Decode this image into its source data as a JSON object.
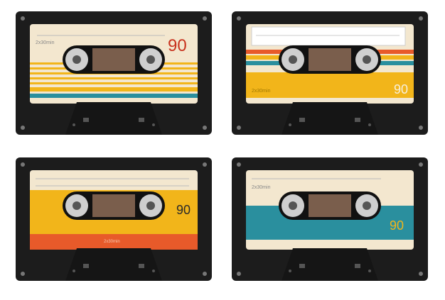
{
  "cassettes": [
    {
      "id": "cassette-1",
      "duration_label": "2x30min",
      "number": "90",
      "number_color": "#c8321e",
      "label_color": "#f3e7cf",
      "stripe_colors": [
        "#f2b51a",
        "#f2b51a",
        "#f2b51a",
        "#f2b51a",
        "#f2b51a",
        "#f2b51a",
        "#2a8f9e"
      ]
    },
    {
      "id": "cassette-2",
      "duration_label": "2x30min",
      "number": "90",
      "number_color": "#f2b51a",
      "label_color": "#f3e7cf",
      "stripe_colors": [
        "#e85a2a",
        "#f2b51a",
        "#2a8f9e",
        "#f2b51a"
      ]
    },
    {
      "id": "cassette-3",
      "duration_label": "2x30min",
      "number": "90",
      "number_color": "#2a2a2a",
      "label_color": "#f3e7cf",
      "stripe_colors": [
        "#f2b51a",
        "#e85a2a"
      ]
    },
    {
      "id": "cassette-4",
      "duration_label": "2x30min",
      "number": "90",
      "number_color": "#f2b51a",
      "label_color": "#f3e7cf",
      "stripe_colors": [
        "#2a8f9e"
      ]
    }
  ]
}
